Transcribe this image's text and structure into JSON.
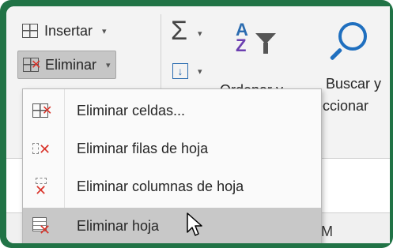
{
  "ribbon": {
    "insert_label": "Insertar",
    "delete_label": "Eliminar",
    "sort_label": "Ordenar y",
    "find_label_line1": "Buscar y",
    "find_label_line2": "leccionar"
  },
  "menu": {
    "items": [
      {
        "label": "Eliminar celdas...",
        "icon": "delete-cells-icon"
      },
      {
        "label": "Eliminar filas de hoja",
        "icon": "delete-rows-icon"
      },
      {
        "label": "Eliminar columnas de hoja",
        "icon": "delete-columns-icon"
      },
      {
        "label": "Eliminar hoja",
        "icon": "delete-sheet-icon"
      }
    ]
  },
  "sheet": {
    "column_label": "M"
  },
  "colors": {
    "frame": "#217346",
    "ribbon_bg": "#f3f3f3",
    "hover": "#c8c8c8",
    "delete_red": "#d9342b"
  }
}
